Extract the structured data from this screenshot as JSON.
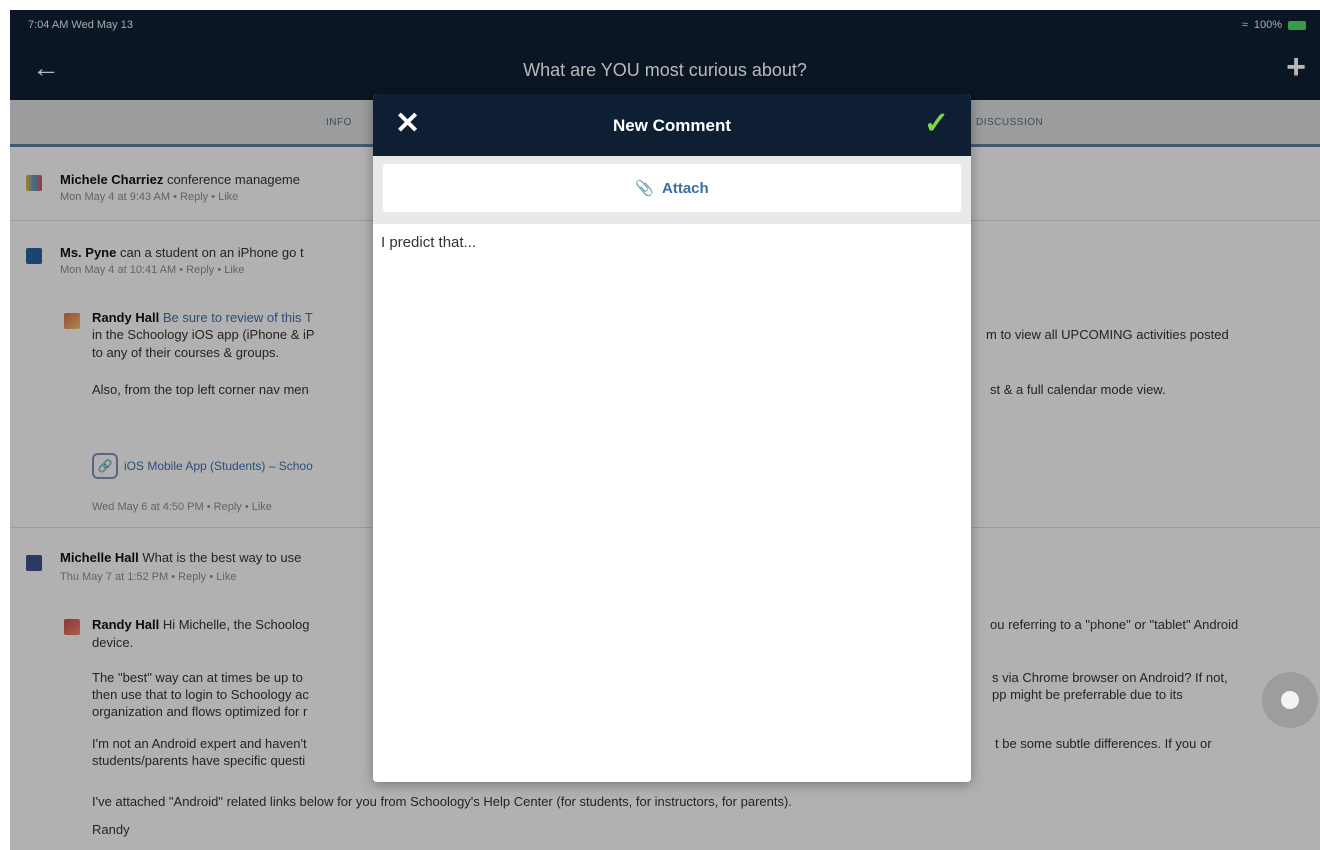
{
  "status_bar": {
    "time": "7:04 AM  Wed May 13",
    "battery": "100%"
  },
  "header": {
    "back_icon": "arrow-left-icon",
    "title": "What are YOU most curious about?",
    "add_icon": "plus-icon"
  },
  "tabs": [
    {
      "label": "INFO"
    },
    {
      "label": "DISCUSSION"
    }
  ],
  "feed": {
    "posts": [
      {
        "name": "Michele Charriez",
        "text": "conference manageme",
        "meta": "Mon May 4 at 9:43 AM • Reply • Like"
      },
      {
        "name": "Ms. Pyne",
        "text": "can a student on an iPhone go t",
        "meta": "Mon May 4 at 10:41 AM • Reply • Like"
      },
      {
        "name": "Randy Hall",
        "link_text": "Be sure to review of this T",
        "line1": "in the Schoology iOS app (iPhone & iP",
        "line1_right": "m to view all UPCOMING activities posted",
        "line2": "to any of their courses & groups.",
        "line3": "Also, from the top left corner nav men",
        "line3_right": "st & a full calendar mode view.",
        "chip": "iOS Mobile App (Students) – Schoo",
        "meta": "Wed May 6 at 4:50 PM • Reply • Like"
      },
      {
        "name": "Michelle Hall",
        "text": "What is the best way to use",
        "meta": "Thu May 7 at 1:52 PM • Reply • Like"
      },
      {
        "name": "Randy Hall",
        "text": "Hi Michelle, the Schoolog",
        "text_right": "ou referring to a \"phone\" or \"tablet\" Android",
        "line2": "device.",
        "p1a": "The \"best\" way can at times be up to",
        "p1a_right": "s via Chrome browser on Android? If not,",
        "p1b": "then use that to login to Schoology ac",
        "p1b_right": "pp might be preferrable due to its",
        "p1c": "organization and flows optimized for r",
        "p2a": "I'm not an Android expert and haven't",
        "p2a_right": "t be some subtle differences. If you or",
        "p2b": "students/parents have specific questi",
        "p3": "I've attached \"Android\" related links below for you from Schoology's Help Center (for students, for instructors, for parents).",
        "sign": "Randy"
      }
    ]
  },
  "modal": {
    "title": "New Comment",
    "close_icon": "close-icon",
    "confirm_icon": "checkmark-icon",
    "attach_label": "Attach",
    "comment_value": "I predict that...",
    "accent": "#7ed348"
  }
}
